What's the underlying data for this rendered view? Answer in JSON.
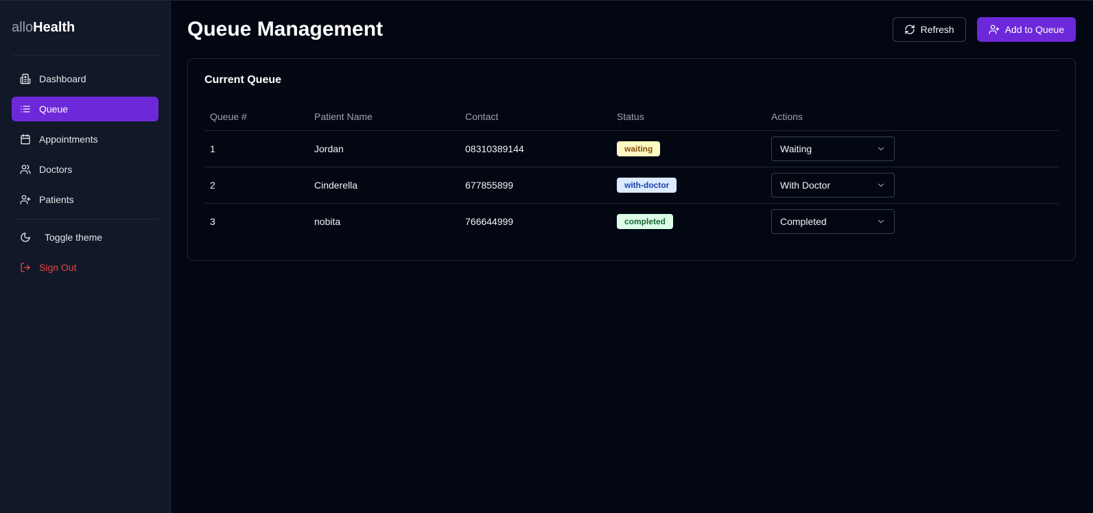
{
  "brand": {
    "light": "allo",
    "bold": "Health"
  },
  "sidebar": {
    "items": [
      {
        "label": "Dashboard",
        "icon": "hospital-icon",
        "active": false
      },
      {
        "label": "Queue",
        "icon": "list-icon",
        "active": true
      },
      {
        "label": "Appointments",
        "icon": "calendar-icon",
        "active": false
      },
      {
        "label": "Doctors",
        "icon": "users-icon",
        "active": false
      },
      {
        "label": "Patients",
        "icon": "user-plus-icon",
        "active": false
      }
    ],
    "toggle_theme": "Toggle theme",
    "sign_out": "Sign Out"
  },
  "header": {
    "title": "Queue Management",
    "refresh_label": "Refresh",
    "add_label": "Add to Queue"
  },
  "queue": {
    "title": "Current Queue",
    "columns": [
      "Queue #",
      "Patient Name",
      "Contact",
      "Status",
      "Actions"
    ],
    "rows": [
      {
        "number": "1",
        "name": "Jordan",
        "contact": "08310389144",
        "status": "waiting",
        "action": "Waiting"
      },
      {
        "number": "2",
        "name": "Cinderella",
        "contact": "677855899",
        "status": "with-doctor",
        "action": "With Doctor"
      },
      {
        "number": "3",
        "name": "nobita",
        "contact": "766644999",
        "status": "completed",
        "action": "Completed"
      }
    ]
  },
  "colors": {
    "accent": "#6d28d9",
    "background": "#030712",
    "sidebar": "#111827",
    "danger": "#ef4444"
  }
}
